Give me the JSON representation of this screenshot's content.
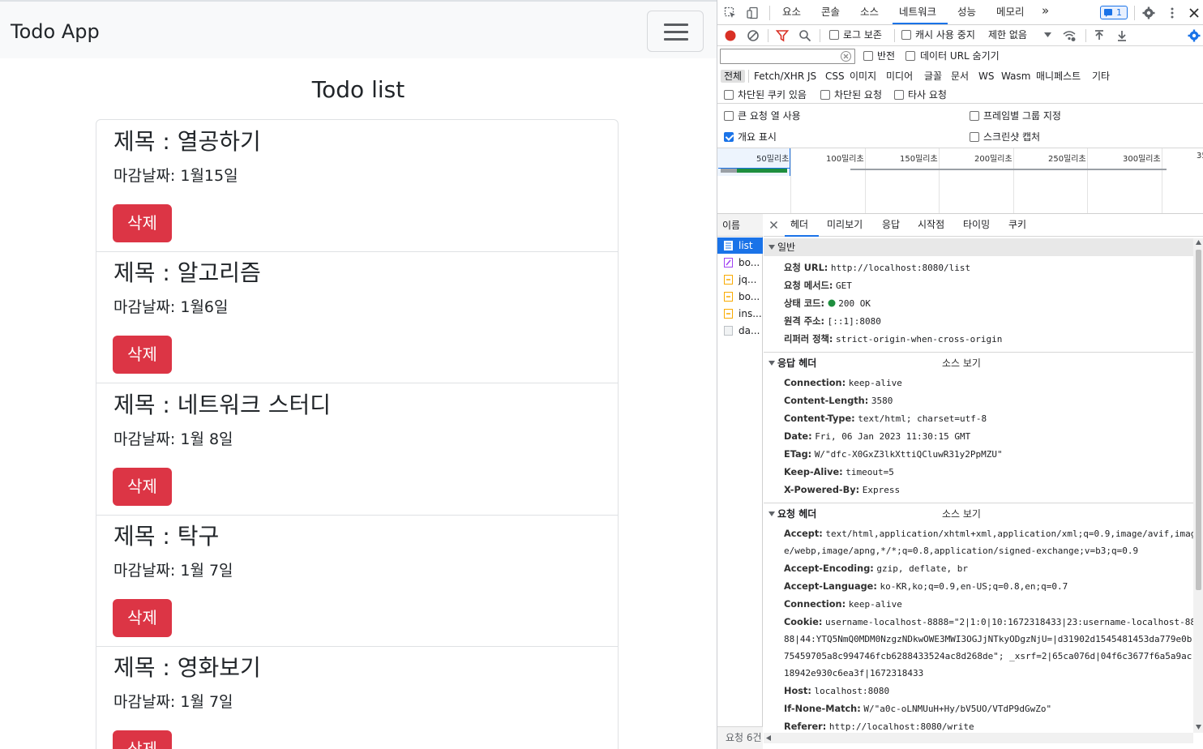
{
  "app": {
    "brand": "Todo App",
    "list_title": "Todo list",
    "items": [
      {
        "title": "제목 : 열공하기",
        "date": "마감날짜: 1월15일",
        "delete_label": "삭제"
      },
      {
        "title": "제목 : 알고리즘",
        "date": "마감날짜: 1월6일",
        "delete_label": "삭제"
      },
      {
        "title": "제목 : 네트워크 스터디",
        "date": "마감날짜: 1월 8일",
        "delete_label": "삭제"
      },
      {
        "title": "제목 : 탁구",
        "date": "마감날짜: 1월 7일",
        "delete_label": "삭제"
      },
      {
        "title": "제목 : 영화보기",
        "date": "마감날짜: 1월 7일",
        "delete_label": "삭제"
      }
    ]
  },
  "devtools": {
    "tabs": [
      "요소",
      "콘솔",
      "소스",
      "네트워크",
      "성능",
      "메모리"
    ],
    "more": "»",
    "issues_badge": "1",
    "toolbar": {
      "preserve_log": "로그 보존",
      "disable_cache": "캐시 사용 중지",
      "throttle": "제한 없음"
    },
    "filter": {
      "placeholder": "",
      "invert": "반전",
      "hide_data_urls": "데이터 URL 숨기기"
    },
    "types": [
      "전체",
      "Fetch/XHR",
      "JS",
      "CSS",
      "이미지",
      "미디어",
      "글꼴",
      "문서",
      "WS",
      "Wasm",
      "매니페스트",
      "기타"
    ],
    "options": {
      "blocked_cookies": "차단된 쿠키 있음",
      "blocked_requests": "차단된 요청",
      "third_party": "타사 요청",
      "big_rows": "큰 요청 열 사용",
      "group_by_frame": "프레임별 그룹 지정",
      "overview": "개요 표시",
      "screenshots": "스크린샷 캡처"
    },
    "timeline_ticks": [
      "50밀리초",
      "100밀리초",
      "150밀리초",
      "200밀리초",
      "250밀리초",
      "300밀리초",
      "35"
    ],
    "name_header": "이름",
    "requests": [
      "list",
      "bo...",
      "jq...",
      "bo...",
      "ins...",
      "da..."
    ],
    "status_bar": "요청 6건",
    "detail_tabs": [
      "헤더",
      "미리보기",
      "응답",
      "시작점",
      "타이밍",
      "쿠키"
    ],
    "general": {
      "title": "일반",
      "rows": [
        {
          "k": "요청 URL:",
          "v": "http://localhost:8080/list"
        },
        {
          "k": "요청 메서드:",
          "v": "GET"
        },
        {
          "k": "상태 코드:",
          "v": "200 OK"
        },
        {
          "k": "원격 주소:",
          "v": "[::1]:8080"
        },
        {
          "k": "리퍼러 정책:",
          "v": "strict-origin-when-cross-origin"
        }
      ]
    },
    "response_headers": {
      "title": "응답 헤더",
      "view_source": "소스 보기",
      "rows": [
        {
          "k": "Connection:",
          "v": "keep-alive"
        },
        {
          "k": "Content-Length:",
          "v": "3580"
        },
        {
          "k": "Content-Type:",
          "v": "text/html; charset=utf-8"
        },
        {
          "k": "Date:",
          "v": "Fri, 06 Jan 2023 11:30:15 GMT"
        },
        {
          "k": "ETag:",
          "v": "W/\"dfc-X0GxZ3lkXttiQCluwR31y2PpMZU\""
        },
        {
          "k": "Keep-Alive:",
          "v": "timeout=5"
        },
        {
          "k": "X-Powered-By:",
          "v": "Express"
        }
      ]
    },
    "request_headers": {
      "title": "요청 헤더",
      "view_source": "소스 보기",
      "accept_k": "Accept:",
      "accept_v1": "text/html,application/xhtml+xml,application/xml;q=0.9,image/avif,imag",
      "accept_v2": "e/webp,image/apng,*/*;q=0.8,application/signed-exchange;v=b3;q=0.9",
      "rows": [
        {
          "k": "Accept-Encoding:",
          "v": "gzip, deflate, br"
        },
        {
          "k": "Accept-Language:",
          "v": "ko-KR,ko;q=0.9,en-US;q=0.8,en;q=0.7"
        },
        {
          "k": "Connection:",
          "v": "keep-alive"
        }
      ],
      "cookie_k": "Cookie:",
      "cookie_v1": "username-localhost-8888=\"2|1:0|10:1672318433|23:username-localhost-88",
      "cookie_v2": "88|44:YTQ5NmQ0MDM0NzgzNDkwOWE3MWI3OGJjNTkyODgzNjU=|d31902d1545481453da779e0b",
      "cookie_v3": "75459705a8c994746fcb6288433524ac8d268de\"; _xsrf=2|65ca076d|04f6c3677f6a5a9ac",
      "cookie_v4": "18942e930c6ea3f|1672318433",
      "rows2": [
        {
          "k": "Host:",
          "v": "localhost:8080"
        },
        {
          "k": "If-None-Match:",
          "v": "W/\"a0c-oLNMUuH+Hy/bV5UO/VTdP9dGwZo\""
        },
        {
          "k": "Referer:",
          "v": "http://localhost:8080/write"
        }
      ]
    },
    "colors": {
      "accent": "#1a73e8",
      "danger": "#dc3545",
      "record": "#d93025"
    }
  }
}
